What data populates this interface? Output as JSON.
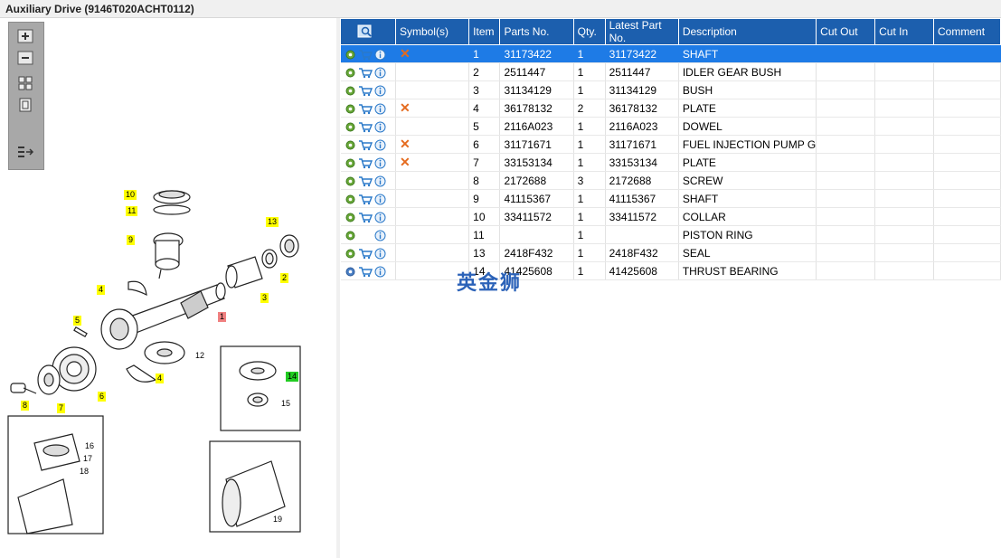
{
  "window": {
    "title": "Auxiliary Drive (9146T020ACHT0112)"
  },
  "toolbar": {
    "buttons": [
      "zoom-in",
      "zoom-out",
      "fit-page",
      "fit-width",
      "list-view"
    ]
  },
  "table": {
    "columns": [
      "",
      "Symbol(s)",
      "Item",
      "Parts No.",
      "Qty.",
      "Latest Part No.",
      "Description",
      "Cut Out",
      "Cut In",
      "Comment"
    ],
    "rows": [
      {
        "item": "1",
        "part": "31173422",
        "qty": "1",
        "latest": "31173422",
        "desc": "SHAFT",
        "cutout": "",
        "cutin": "",
        "comment": "",
        "symbol": "x",
        "cart": true,
        "selected": true
      },
      {
        "item": "2",
        "part": "2511447",
        "qty": "1",
        "latest": "2511447",
        "desc": "IDLER GEAR BUSH",
        "cutout": "",
        "cutin": "",
        "comment": "",
        "symbol": "",
        "cart": true,
        "selected": false
      },
      {
        "item": "3",
        "part": "31134129",
        "qty": "1",
        "latest": "31134129",
        "desc": "BUSH",
        "cutout": "",
        "cutin": "",
        "comment": "",
        "symbol": "",
        "cart": true,
        "selected": false
      },
      {
        "item": "4",
        "part": "36178132",
        "qty": "2",
        "latest": "36178132",
        "desc": "PLATE",
        "cutout": "",
        "cutin": "",
        "comment": "",
        "symbol": "x",
        "cart": true,
        "selected": false
      },
      {
        "item": "5",
        "part": "2116A023",
        "qty": "1",
        "latest": "2116A023",
        "desc": "DOWEL",
        "cutout": "",
        "cutin": "",
        "comment": "",
        "symbol": "",
        "cart": true,
        "selected": false
      },
      {
        "item": "6",
        "part": "31171671",
        "qty": "1",
        "latest": "31171671",
        "desc": "FUEL INJECTION PUMP G",
        "cutout": "",
        "cutin": "",
        "comment": "",
        "symbol": "x",
        "cart": true,
        "selected": false
      },
      {
        "item": "7",
        "part": "33153134",
        "qty": "1",
        "latest": "33153134",
        "desc": "PLATE",
        "cutout": "",
        "cutin": "",
        "comment": "",
        "symbol": "x",
        "cart": true,
        "selected": false
      },
      {
        "item": "8",
        "part": "2172688",
        "qty": "3",
        "latest": "2172688",
        "desc": "SCREW",
        "cutout": "",
        "cutin": "",
        "comment": "",
        "symbol": "",
        "cart": true,
        "selected": false
      },
      {
        "item": "9",
        "part": "41115367",
        "qty": "1",
        "latest": "41115367",
        "desc": "SHAFT",
        "cutout": "",
        "cutin": "",
        "comment": "",
        "symbol": "",
        "cart": true,
        "selected": false
      },
      {
        "item": "10",
        "part": "33411572",
        "qty": "1",
        "latest": "33411572",
        "desc": "COLLAR",
        "cutout": "",
        "cutin": "",
        "comment": "",
        "symbol": "",
        "cart": true,
        "selected": false
      },
      {
        "item": "11",
        "part": "",
        "qty": "1",
        "latest": "",
        "desc": "PISTON RING",
        "cutout": "",
        "cutin": "",
        "comment": "",
        "symbol": "",
        "cart": false,
        "selected": false
      },
      {
        "item": "13",
        "part": "2418F432",
        "qty": "1",
        "latest": "2418F432",
        "desc": "SEAL",
        "cutout": "",
        "cutin": "",
        "comment": "",
        "symbol": "",
        "cart": true,
        "selected": false
      },
      {
        "item": "14",
        "part": "41425608",
        "qty": "1",
        "latest": "41425608",
        "desc": "THRUST BEARING",
        "cutout": "",
        "cutin": "",
        "comment": "",
        "symbol": "",
        "cart": true,
        "selected": false
      }
    ]
  },
  "watermark": "英金狮",
  "diagram": {
    "callouts": [
      "10",
      "11",
      "13",
      "9",
      "2",
      "3",
      "4",
      "1",
      "5",
      "12",
      "4",
      "14",
      "15",
      "8",
      "7",
      "6",
      "16",
      "17",
      "18",
      "19"
    ]
  },
  "colors": {
    "header": "#1c5fae",
    "selected": "#1e7be6",
    "x_mark": "#e56b1f",
    "callout_yellow": "#ffff00",
    "callout_red": "#f08080",
    "callout_green": "#22cc22"
  }
}
